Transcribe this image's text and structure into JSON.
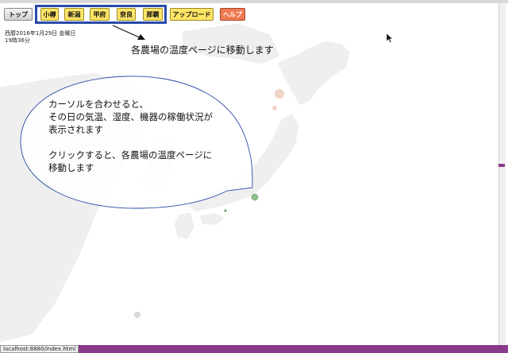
{
  "nav": {
    "top_label": "トップ",
    "farms": [
      "小樽",
      "新潟",
      "甲府",
      "奈良",
      "那覇"
    ],
    "upload_label": "アップロード",
    "help_label": "ヘルプ"
  },
  "datetime": {
    "date": "西暦2016年1月29日 金曜日",
    "time": "19時36分"
  },
  "annotations": {
    "top_note": "各農場の温度ページに移動します",
    "bubble_text": "カーソルを合わせると、\nその日の気温、湿度、機器の稼働状況が\n表示されます\n\nクリックすると、各農場の温度ページに\n移動します"
  },
  "status": {
    "url": "localhost:8880/index.html"
  },
  "colors": {
    "highlight": "#2a4aa8",
    "farm_button": "#ffe566",
    "help_button": "#f07a52",
    "statusbar": "#8a3a8a"
  }
}
